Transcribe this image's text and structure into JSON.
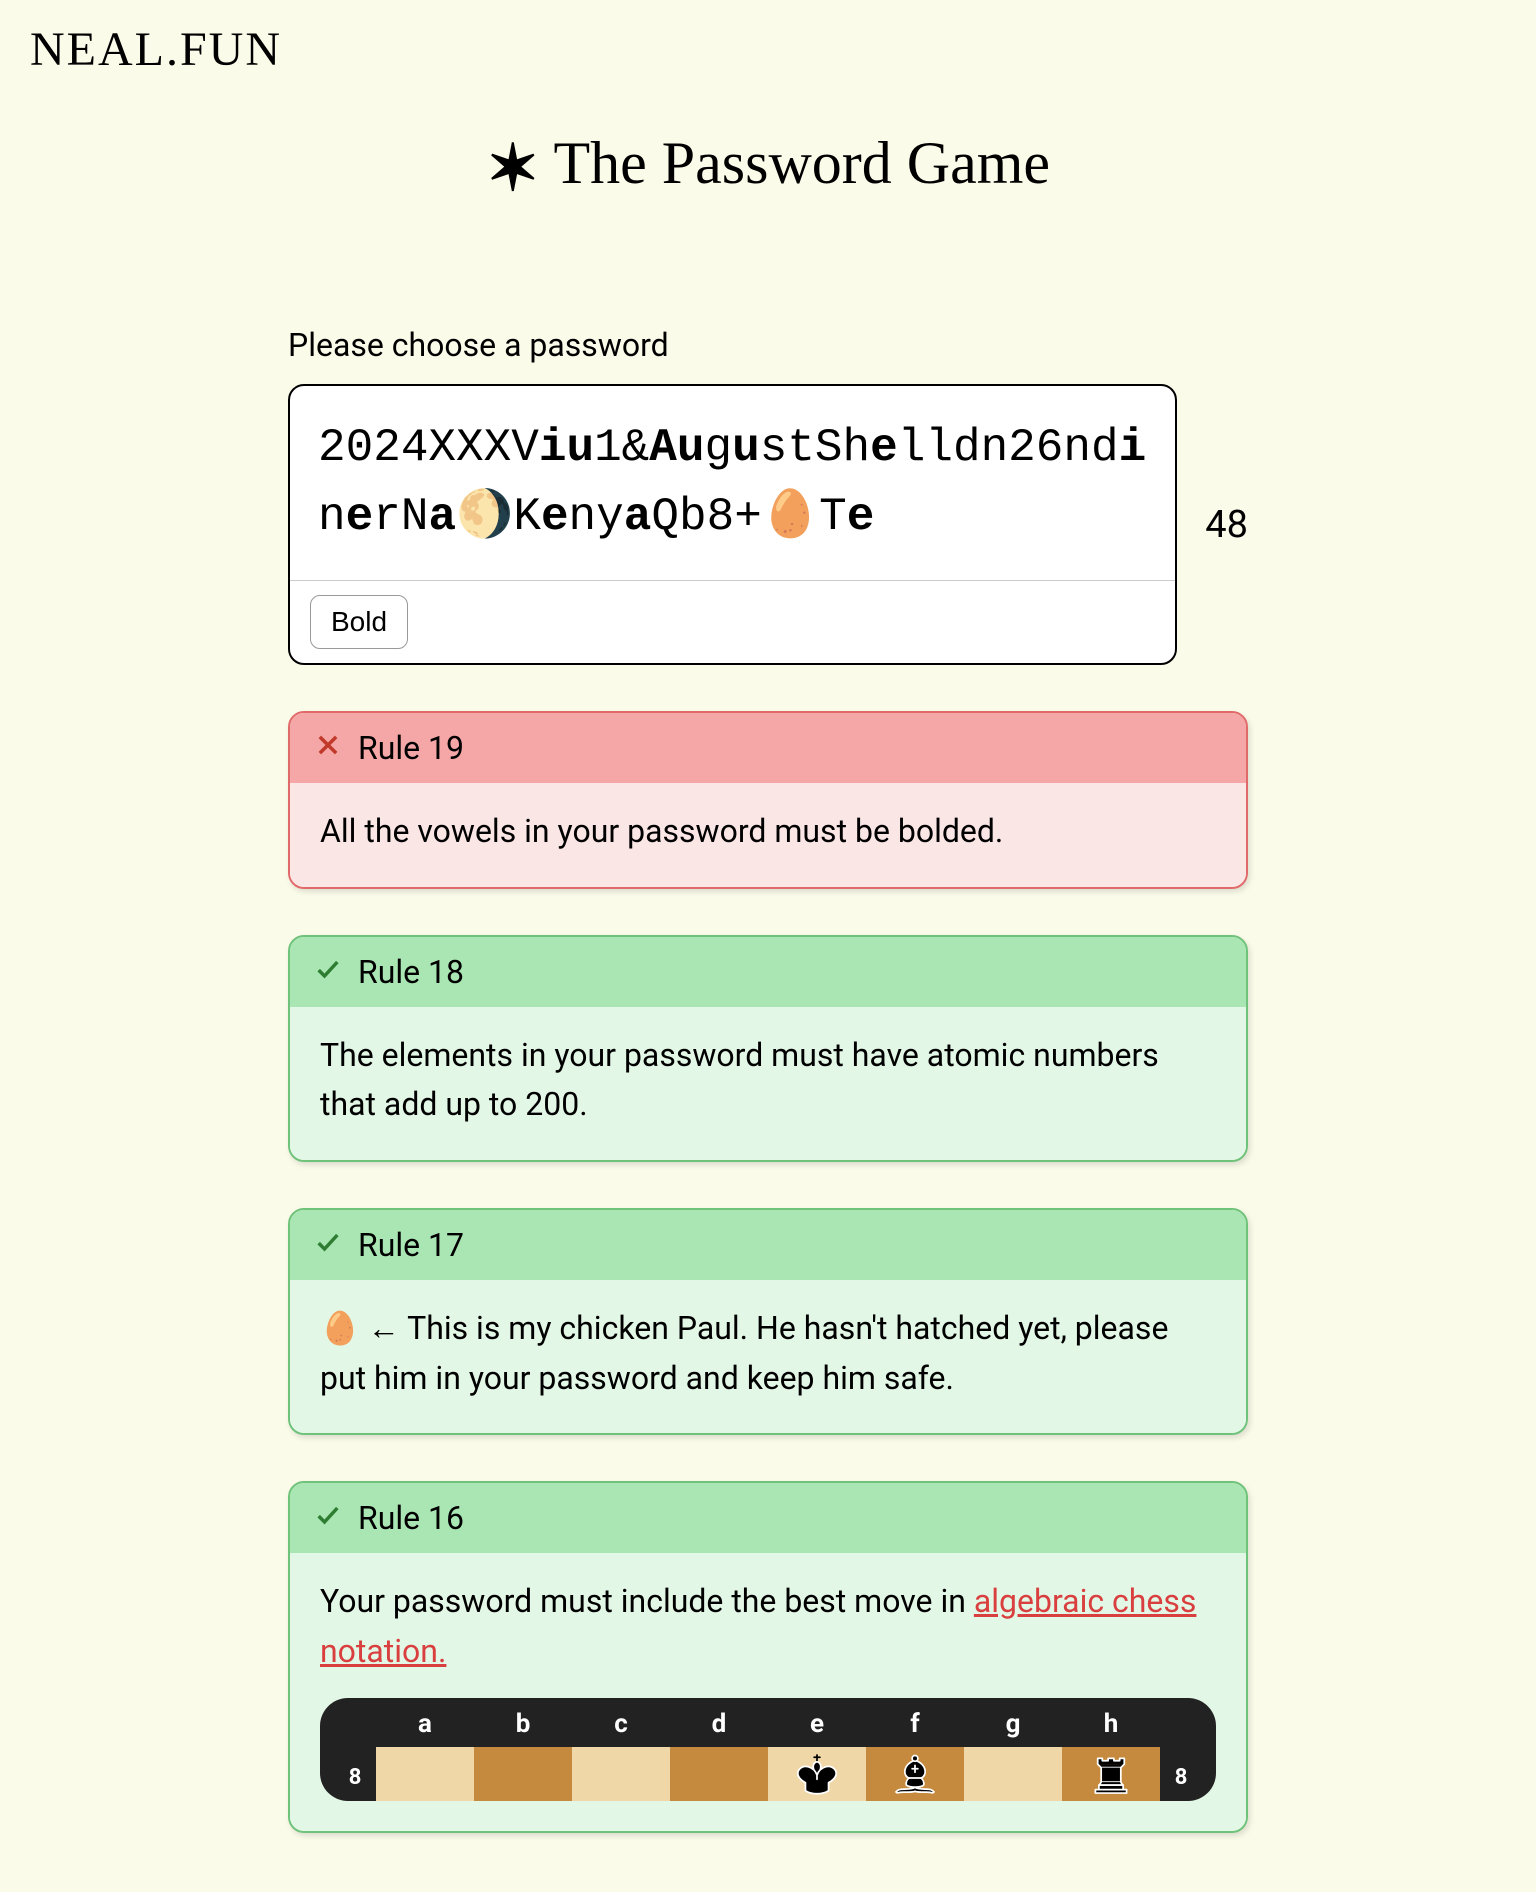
{
  "site": {
    "logo": "NEAL.FUN"
  },
  "page": {
    "title_prefix": "✶",
    "title": "The Password Game",
    "prompt_label": "Please choose a password",
    "char_count": "48",
    "bold_button_label": "Bold"
  },
  "password": {
    "segments": [
      {
        "t": "2024XXXV",
        "b": false
      },
      {
        "t": "iu",
        "b": true
      },
      {
        "t": "1&",
        "b": false
      },
      {
        "t": "Au",
        "b": true
      },
      {
        "t": "g",
        "b": false
      },
      {
        "t": "u",
        "b": true
      },
      {
        "t": "stSh",
        "b": false
      },
      {
        "t": "e",
        "b": true
      },
      {
        "t": "lldn26nd",
        "b": false
      },
      {
        "t": "i",
        "b": true
      },
      {
        "t": "n",
        "b": false
      },
      {
        "t": "e",
        "b": true
      },
      {
        "t": "rN",
        "b": false
      },
      {
        "t": "a",
        "b": true
      },
      {
        "t": "🌖K",
        "b": false
      },
      {
        "t": "e",
        "b": true
      },
      {
        "t": "ny",
        "b": false
      },
      {
        "t": "a",
        "b": true
      },
      {
        "t": "Qb8+🥚T",
        "b": false
      },
      {
        "t": "e",
        "b": true
      }
    ]
  },
  "rules": [
    {
      "number": "Rule 19",
      "status": "fail",
      "body": "All the vowels in your password must be bolded."
    },
    {
      "number": "Rule 18",
      "status": "pass",
      "body": "The elements in your password must have atomic numbers that add up to 200."
    },
    {
      "number": "Rule 17",
      "status": "pass",
      "body": "🥚 ← This is my chicken Paul. He hasn't hatched yet, please put him in your password and keep him safe."
    },
    {
      "number": "Rule 16",
      "status": "pass",
      "body_prefix": "Your password must include the best move in ",
      "link_text": "algebraic chess notation.",
      "has_chess": true
    }
  ],
  "chess": {
    "files": [
      "a",
      "b",
      "c",
      "d",
      "e",
      "f",
      "g",
      "h"
    ],
    "top_rank_label": "8",
    "row8": [
      {
        "sq": "light",
        "piece": null
      },
      {
        "sq": "dark",
        "piece": null
      },
      {
        "sq": "light",
        "piece": null
      },
      {
        "sq": "dark",
        "piece": null
      },
      {
        "sq": "light",
        "piece": "black-king"
      },
      {
        "sq": "dark",
        "piece": "black-bishop"
      },
      {
        "sq": "light",
        "piece": null
      },
      {
        "sq": "dark",
        "piece": "black-rook"
      }
    ]
  }
}
